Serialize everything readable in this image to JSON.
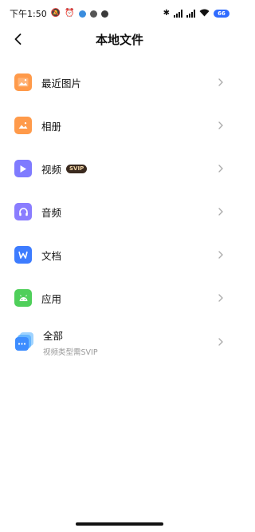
{
  "status_bar": {
    "time": "下午1:50",
    "battery": "66"
  },
  "header": {
    "title": "本地文件"
  },
  "items": [
    {
      "label": "最近图片",
      "icon": "image-icon",
      "color": "#ff9a4a"
    },
    {
      "label": "相册",
      "icon": "album-icon",
      "color": "#ff9a4a"
    },
    {
      "label": "视频",
      "icon": "video-icon",
      "color": "#7f7bff",
      "badge": "SVIP"
    },
    {
      "label": "音频",
      "icon": "headphones-icon",
      "color": "#8a7dff"
    },
    {
      "label": "文档",
      "icon": "document-icon",
      "color": "#3d7cff"
    },
    {
      "label": "应用",
      "icon": "android-icon",
      "color": "#4fcf5a"
    },
    {
      "label": "全部",
      "icon": "all-files-icon",
      "color": "#4aa7ff",
      "sublabel": "视频类型需SVIP"
    }
  ]
}
